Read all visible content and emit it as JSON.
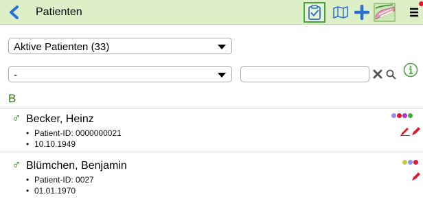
{
  "header": {
    "title": "Patienten",
    "icons": [
      "back-icon",
      "clipboard-check-icon",
      "map-icon",
      "plus-icon",
      "hand-icon",
      "menu-icon"
    ],
    "colors": {
      "bar": "#dcefc6",
      "accent_blue": "#2b6fd6",
      "active_border": "#4aa33a"
    }
  },
  "filters": {
    "status_select": "Aktive Patienten (33)",
    "category_select": "-",
    "search_placeholder": ""
  },
  "group": {
    "letter": "B"
  },
  "patients": [
    {
      "name": "Becker, Heinz",
      "gender_symbol": "♂",
      "patient_id": "Patient-ID: 0000000021",
      "birthdate": "10.10.1949",
      "dot_colors": [
        "#8a8ff0",
        "#e0162b",
        "#b431c8",
        "#3bb02f"
      ],
      "action_icons": [
        "pen-line-icon",
        "marker-icon"
      ]
    },
    {
      "name": "Blümchen, Benjamin",
      "gender_symbol": "♂",
      "patient_id": "Patient-ID: 0027",
      "birthdate": "01.01.1970",
      "dot_colors": [
        "#c8c83a",
        "#8a8ff0",
        "#e0162b"
      ],
      "action_icons": [
        "marker-icon"
      ]
    }
  ]
}
